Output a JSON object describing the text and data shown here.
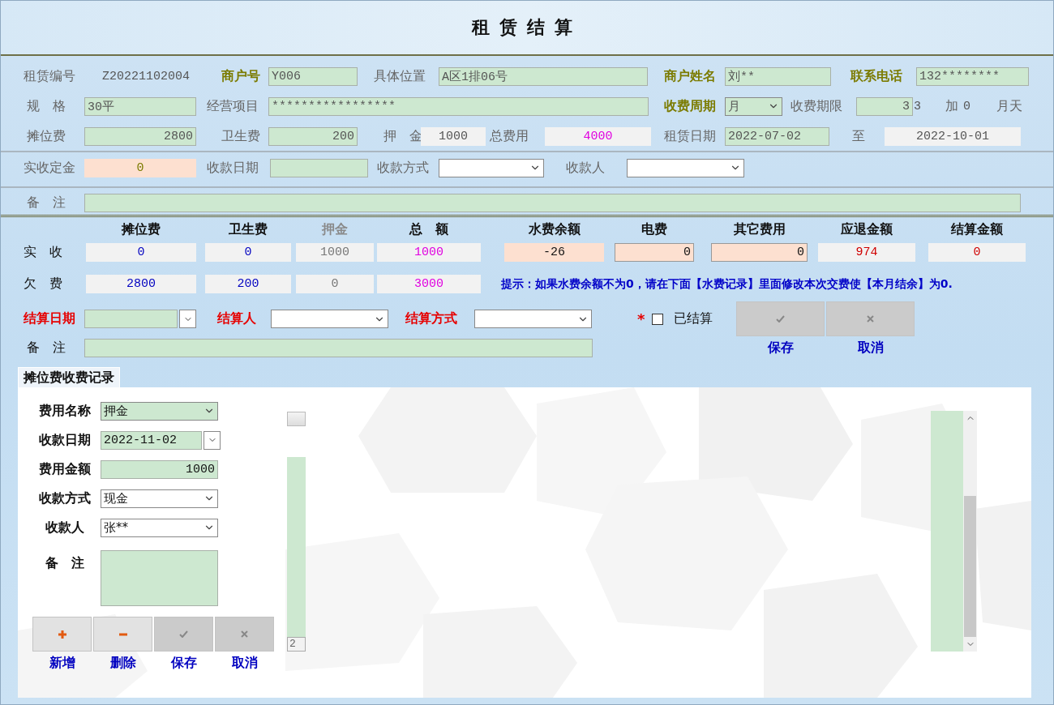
{
  "title": "租赁结算",
  "header": {
    "sections": [
      [
        [
          {
            "kind": "label",
            "text": "租赁编号",
            "color": "#666666",
            "bold": false
          },
          {
            "kind": "text",
            "text": "Z20221102004",
            "color": "#555555"
          },
          {
            "kind": "label",
            "text": "商户号",
            "color": "#7b7b00",
            "bold": true
          },
          {
            "kind": "input",
            "value": "Y006",
            "color": "#555555"
          },
          {
            "kind": "label",
            "text": "具体位置",
            "color": "#666666",
            "bold": false
          },
          {
            "kind": "input",
            "value": "A区1排06号",
            "color": "#555555"
          },
          {
            "kind": "label",
            "text": "商户姓名",
            "color": "#7b7b00",
            "bold": true
          },
          {
            "kind": "input",
            "value": "刘**",
            "color": "#555555"
          },
          {
            "kind": "label",
            "text": "联系电话",
            "color": "#7b7b00",
            "bold": true
          },
          {
            "kind": "input",
            "value": "132********",
            "color": "#555555"
          }
        ],
        [
          {
            "kind": "label",
            "text": "规　格",
            "color": "#666666",
            "bold": false
          },
          {
            "kind": "input",
            "value": "30平",
            "color": "#555555"
          },
          {
            "kind": "label",
            "text": "经营项目",
            "color": "#666666",
            "bold": false
          },
          {
            "kind": "input",
            "value": "*****************",
            "color": "#555555"
          },
          {
            "kind": "label",
            "text": "收费周期",
            "color": "#7b7b00",
            "bold": true
          },
          {
            "kind": "combo",
            "value": "月",
            "color": "#555555"
          },
          {
            "kind": "label",
            "text": "收费期限",
            "color": "#666666",
            "bold": false
          },
          {
            "kind": "input",
            "value": "3",
            "color": "#555555",
            "numeric": true
          },
          {
            "kind": "text",
            "text": "3",
            "color": "#555555"
          },
          {
            "kind": "label",
            "text": "加",
            "color": "#666666",
            "bold": false
          },
          {
            "kind": "text",
            "text": "0",
            "color": "#555555"
          },
          {
            "kind": "label",
            "text": "月天",
            "color": "#666666",
            "bold": false
          }
        ],
        [
          {
            "kind": "label",
            "text": "摊位费",
            "color": "#666666",
            "bold": false
          },
          {
            "kind": "input",
            "value": "2800",
            "color": "#555555",
            "numeric": true
          },
          {
            "kind": "label",
            "text": "卫生费",
            "color": "#666666",
            "bold": false
          },
          {
            "kind": "input",
            "value": "200",
            "color": "#555555",
            "numeric": true
          },
          {
            "kind": "label",
            "text": "押　金",
            "color": "#666666",
            "bold": false
          },
          {
            "kind": "readout",
            "value": "1000",
            "color": "#555555"
          },
          {
            "kind": "label",
            "text": "总费用",
            "color": "#666666",
            "bold": false
          },
          {
            "kind": "readout",
            "value": "4000",
            "color": "#e000e0"
          },
          {
            "kind": "label",
            "text": "租赁日期",
            "color": "#666666",
            "bold": false
          },
          {
            "kind": "input",
            "value": "2022-07-02",
            "color": "#555555"
          },
          {
            "kind": "label",
            "text": "至",
            "color": "#666666",
            "bold": false
          },
          {
            "kind": "readout",
            "value": "2022-10-01",
            "color": "#555555"
          }
        ]
      ],
      [
        [
          {
            "kind": "label",
            "text": "实收定金",
            "color": "#666666",
            "bold": false
          },
          {
            "kind": "tinted",
            "value": "0",
            "color": "#7b7b00"
          },
          {
            "kind": "label",
            "text": "收款日期",
            "color": "#666666",
            "bold": false
          },
          {
            "kind": "input"
          },
          {
            "kind": "label",
            "text": "收款方式",
            "color": "#666666",
            "bold": false
          },
          {
            "kind": "select"
          },
          {
            "kind": "label",
            "text": "收款人",
            "color": "#666666",
            "bold": false
          },
          {
            "kind": "select"
          }
        ]
      ],
      [
        [
          {
            "kind": "label",
            "text": "备　注",
            "color": "#666666",
            "bold": false
          },
          {
            "kind": "input"
          }
        ]
      ]
    ]
  },
  "summary": {
    "columns": [
      {
        "text": "摊位费",
        "color": "#111111"
      },
      {
        "text": "卫生费",
        "color": "#111111"
      },
      {
        "text": "押金",
        "color": "#8a8a8a"
      },
      {
        "text": "总　额",
        "color": "#111111"
      },
      {
        "text": "水费余额",
        "color": "#111111"
      },
      {
        "text": "电费",
        "color": "#111111"
      },
      {
        "text": "其它费用",
        "color": "#111111"
      },
      {
        "text": "应退金额",
        "color": "#111111"
      },
      {
        "text": "结算金额",
        "color": "#111111"
      }
    ],
    "rows": [
      {
        "label": "实　收",
        "cells": [
          {
            "kind": "readout",
            "value": "0",
            "color": "#0000c0"
          },
          {
            "kind": "readout",
            "value": "0",
            "color": "#0000c0"
          },
          {
            "kind": "readout",
            "value": "1000",
            "color": "#777777"
          },
          {
            "kind": "readout",
            "value": "1000",
            "color": "#e000e0"
          },
          {
            "kind": "tinted",
            "value": "-26",
            "color": "#111111"
          },
          {
            "kind": "charge",
            "value": "0",
            "color": "#111111"
          },
          {
            "kind": "charge",
            "value": "0",
            "color": "#111111"
          },
          {
            "kind": "readout",
            "value": "974",
            "color": "#d00000"
          },
          {
            "kind": "readout",
            "value": "0",
            "color": "#d00000"
          }
        ]
      },
      {
        "label": "欠　费",
        "cells": [
          {
            "kind": "readout",
            "value": "2800",
            "color": "#0000c0"
          },
          {
            "kind": "readout",
            "value": "200",
            "color": "#0000c0"
          },
          {
            "kind": "readout",
            "value": "0",
            "color": "#777777"
          },
          {
            "kind": "readout",
            "value": "3000",
            "color": "#e000e0"
          }
        ],
        "hint": "提示：如果水费余额不为0，请在下面【水费记录】里面修改本次交费使【本月结余】为0."
      }
    ]
  },
  "settlement": {
    "items": [
      {
        "kind": "label",
        "text": "结算日期",
        "color": "#e60000",
        "bold": true
      },
      {
        "kind": "date"
      },
      {
        "kind": "label",
        "text": "结算人",
        "color": "#e60000",
        "bold": true
      },
      {
        "kind": "select"
      },
      {
        "kind": "label",
        "text": "结算方式",
        "color": "#e60000",
        "bold": true
      },
      {
        "kind": "select"
      },
      {
        "kind": "marker",
        "text": "*"
      },
      {
        "kind": "checkbox",
        "checked": false
      },
      {
        "kind": "label",
        "text": "已结算",
        "color": "#111111",
        "bold": false
      }
    ],
    "note": [
      {
        "kind": "label",
        "text": "备　注",
        "color": "#111111",
        "bold": false
      },
      {
        "kind": "input"
      }
    ],
    "buttons": [
      {
        "kind": "save",
        "caption": "保存",
        "disabled": true
      },
      {
        "kind": "cancel",
        "caption": "取消",
        "disabled": true
      }
    ]
  },
  "tabs": [
    {
      "label": "摊位费收费记录",
      "selected": true
    }
  ],
  "record_form": {
    "fields": [
      {
        "label": "费用名称",
        "kind": "combo",
        "value": "押金"
      },
      {
        "label": "收款日期",
        "kind": "date",
        "value": "2022-11-02"
      },
      {
        "label": "费用金额",
        "kind": "input",
        "value": "1000",
        "numeric": true
      },
      {
        "label": "收款方式",
        "kind": "select",
        "value": "现金"
      },
      {
        "label": "收款人",
        "kind": "select",
        "value": "张**"
      },
      {
        "label": "备　注",
        "kind": "textarea"
      }
    ],
    "buttons": [
      {
        "kind": "add",
        "caption": "新增",
        "disabled": false
      },
      {
        "kind": "delete",
        "caption": "删除",
        "disabled": false
      },
      {
        "kind": "save",
        "caption": "保存",
        "disabled": true
      },
      {
        "kind": "cancel",
        "caption": "取消",
        "disabled": true
      }
    ]
  },
  "record_number": "2"
}
